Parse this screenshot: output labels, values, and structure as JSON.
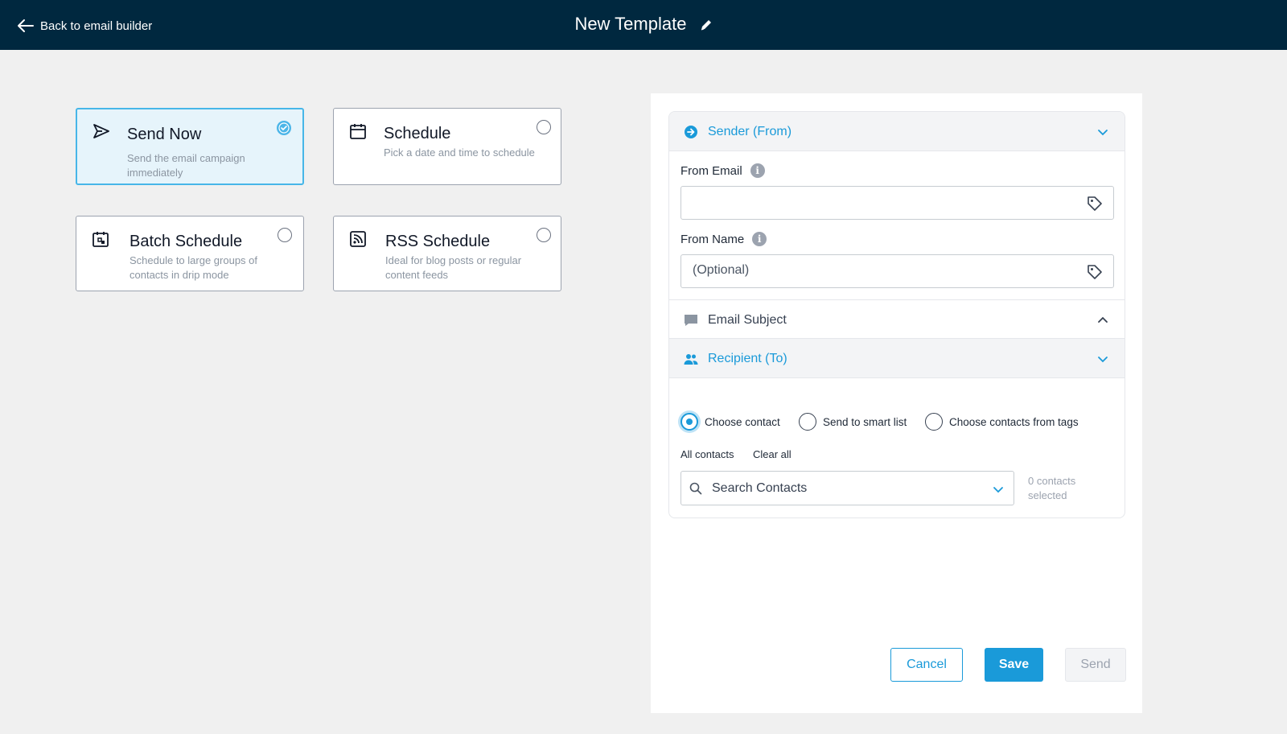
{
  "header": {
    "back_label": "Back to email builder",
    "title": "New Template"
  },
  "options": [
    {
      "title": "Send Now",
      "description": "Send the email campaign immediately",
      "selected": true,
      "icon": "send-icon"
    },
    {
      "title": "Schedule",
      "description": "Pick a date and time to schedule",
      "selected": false,
      "icon": "calendar-icon"
    },
    {
      "title": "Batch Schedule",
      "description": "Schedule to large groups of contacts in drip mode",
      "selected": false,
      "icon": "batch-calendar-icon"
    },
    {
      "title": "RSS Schedule",
      "description": "Ideal for blog posts or regular content feeds",
      "selected": false,
      "icon": "rss-icon"
    }
  ],
  "sender": {
    "heading": "Sender (From)",
    "from_email_label": "From Email",
    "from_email_value": "",
    "from_name_label": "From Name",
    "from_name_placeholder": "(Optional)"
  },
  "subject": {
    "heading": "Email Subject"
  },
  "recipient": {
    "heading": "Recipient (To)",
    "radio_options": [
      "Choose contact",
      "Send to smart list",
      "Choose contacts from tags"
    ],
    "selected_option": "Choose contact",
    "all_contacts_link": "All contacts",
    "clear_all_link": "Clear all",
    "search_placeholder": "Search Contacts",
    "count_text": "0 contacts selected"
  },
  "actions": {
    "cancel": "Cancel",
    "save": "Save",
    "send": "Send"
  },
  "colors": {
    "header_bg": "#00283f",
    "accent": "#1a9ad9",
    "selected_card_bg": "#e6f4fb"
  }
}
